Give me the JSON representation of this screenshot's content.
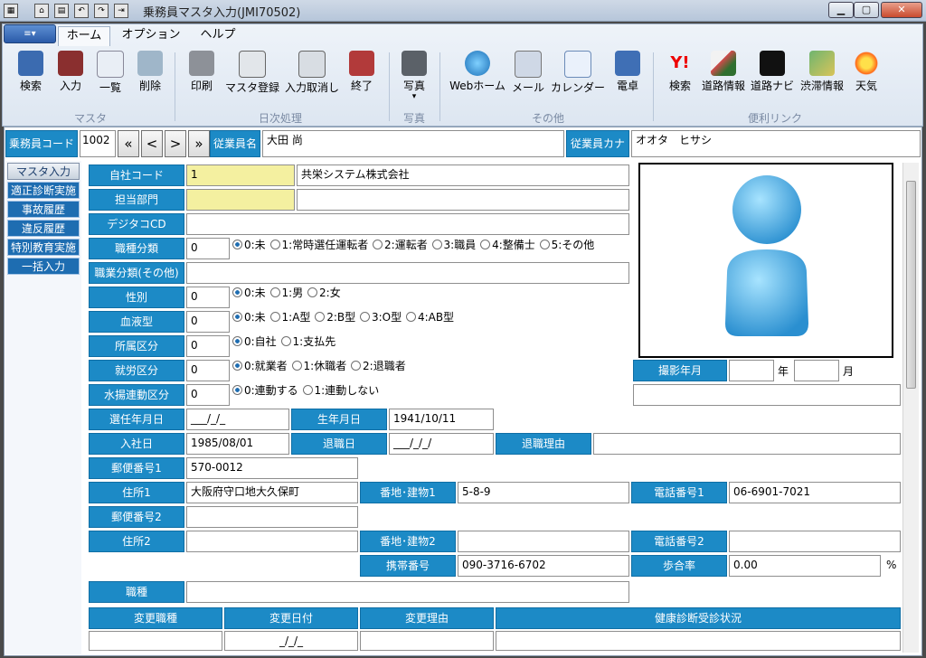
{
  "window": {
    "title": "乗務員マスタ入力(JMI70502)",
    "minimize": "▁",
    "maximize": "▢",
    "close": "✕"
  },
  "ribbon": {
    "app_menu": "≡▾",
    "tabs": [
      "ホーム",
      "オプション",
      "ヘルプ"
    ],
    "buttons": [
      {
        "label": "検索",
        "icon": "search-book-icon"
      },
      {
        "label": "入力",
        "icon": "input-book-icon"
      },
      {
        "label": "一覧",
        "icon": "list-icon"
      },
      {
        "label": "削除",
        "icon": "trash-icon"
      },
      {
        "label": "印刷",
        "icon": "printer-icon"
      },
      {
        "label": "マスタ登録",
        "icon": "register-icon"
      },
      {
        "label": "入力取消し",
        "icon": "eraser-icon"
      },
      {
        "label": "終了",
        "icon": "exit-icon"
      },
      {
        "label": "写真",
        "icon": "camera-icon"
      },
      {
        "label": "Webホーム",
        "icon": "globe-icon"
      },
      {
        "label": "メール",
        "icon": "mail-icon"
      },
      {
        "label": "カレンダー",
        "icon": "calendar-icon"
      },
      {
        "label": "電卓",
        "icon": "calculator-icon"
      },
      {
        "label": "検索",
        "icon": "yahoo-icon"
      },
      {
        "label": "道路情報",
        "icon": "road-info-icon"
      },
      {
        "label": "道路ナビ",
        "icon": "road-navi-icon"
      },
      {
        "label": "渋滞情報",
        "icon": "traffic-icon"
      },
      {
        "label": "天気",
        "icon": "weather-icon"
      }
    ],
    "photo_dropdown": "▾",
    "groups": [
      "マスタ",
      "日次処理",
      "写真",
      "その他",
      "便利リンク"
    ]
  },
  "header": {
    "code_label": "乗務員コード",
    "code_value": "1002",
    "nav_first": "«",
    "nav_prev": "<",
    "nav_next": ">",
    "nav_last": "»",
    "name_label": "従業員名",
    "name_value": "大田 尚",
    "kana_label": "従業員カナ",
    "kana_value": "オオタ　ヒサシ"
  },
  "sidebar": {
    "items": [
      "マスタ入力",
      "適正診断実施",
      "事故履歴",
      "違反履歴",
      "特別教育実施",
      "一括入力"
    ]
  },
  "form": {
    "company_code": {
      "label": "自社コード",
      "value": "1",
      "name": "共栄システム株式会社"
    },
    "department": {
      "label": "担当部門",
      "value": "",
      "name": ""
    },
    "digitaco": {
      "label": "デジタコCD",
      "value": ""
    },
    "job_class": {
      "label": "職種分類",
      "value": "0",
      "options": [
        "0:未",
        "1:常時選任運転者",
        "2:運転者",
        "3:職員",
        "4:整備士",
        "5:その他"
      ]
    },
    "job_other": {
      "label": "職業分類(その他)",
      "value": ""
    },
    "gender": {
      "label": "性別",
      "value": "0",
      "options": [
        "0:未",
        "1:男",
        "2:女"
      ]
    },
    "blood": {
      "label": "血液型",
      "value": "0",
      "options": [
        "0:未",
        "1:A型",
        "2:B型",
        "3:O型",
        "4:AB型"
      ]
    },
    "affiliation": {
      "label": "所属区分",
      "value": "0",
      "options": [
        "0:自社",
        "1:支払先"
      ]
    },
    "employment": {
      "label": "就労区分",
      "value": "0",
      "options": [
        "0:就業者",
        "1:休職者",
        "2:退職者"
      ]
    },
    "mizuage": {
      "label": "水揚連動区分",
      "value": "0",
      "options": [
        "0:連動する",
        "1:連動しない"
      ]
    },
    "appoint_date": {
      "label": "選任年月日",
      "value": "___/_/_"
    },
    "birth_date": {
      "label": "生年月日",
      "value": "1941/10/11"
    },
    "join_date": {
      "label": "入社日",
      "value": "1985/08/01"
    },
    "retire_date": {
      "label": "退職日",
      "value": "___/_/_/"
    },
    "retire_reason": {
      "label": "退職理由",
      "value": ""
    },
    "zip1": {
      "label": "郵便番号1",
      "value": "570-0012"
    },
    "address1": {
      "label": "住所1",
      "value": "大阪府守口地大久保町"
    },
    "bldg1": {
      "label": "番地･建物1",
      "value": "5-8-9"
    },
    "tel1": {
      "label": "電話番号1",
      "value": "06-6901-7021"
    },
    "zip2": {
      "label": "郵便番号2",
      "value": ""
    },
    "address2": {
      "label": "住所2",
      "value": ""
    },
    "bldg2": {
      "label": "番地･建物2",
      "value": ""
    },
    "tel2": {
      "label": "電話番号2",
      "value": ""
    },
    "mobile": {
      "label": "携帯番号",
      "value": "090-3716-6702"
    },
    "commission": {
      "label": "歩合率",
      "value": "0.00",
      "unit": "%"
    },
    "history": {
      "label": "職種",
      "value": ""
    },
    "photo": {
      "label": "撮影年月",
      "year_unit": "年",
      "month_unit": "月",
      "year": "",
      "month": ""
    }
  },
  "table": {
    "headers": [
      "変更職種",
      "変更日付",
      "変更理由",
      "健康診断受診状況"
    ],
    "rows": [
      [
        "",
        "_/_/_",
        "",
        ""
      ]
    ]
  },
  "colors": {
    "label_bg": "#1c8ac6",
    "sidebar_bg": "#1e6db1",
    "required_bg": "#f4f0a0"
  }
}
